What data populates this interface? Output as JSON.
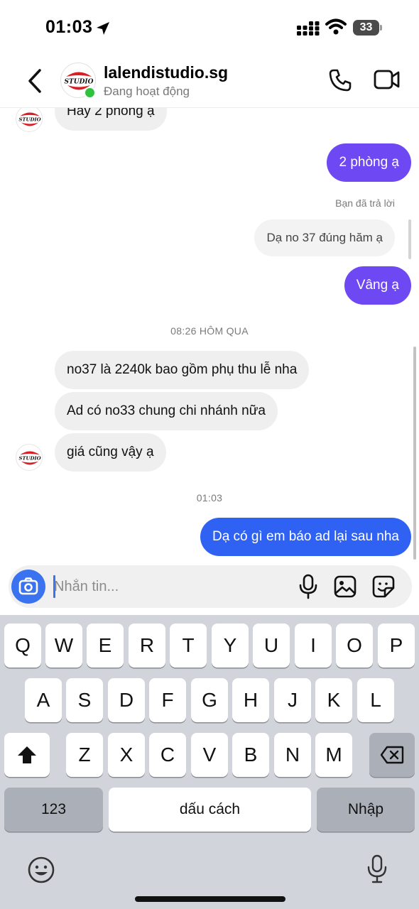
{
  "status_bar": {
    "time": "01:03",
    "battery": "33"
  },
  "header": {
    "contact_name": "lalendistudio.sg",
    "contact_status": "Đang hoạt động",
    "avatar_text": "STUDIO"
  },
  "messages": {
    "m1": "Hay 2 phòng ạ",
    "m2": "2 phòng ạ",
    "reply_label": "Bạn đã trả lời",
    "m3_quoted": "Dạ no 37 đúng hăm ạ",
    "m4": "Vâng ạ",
    "timestamp1": "08:26 HÔM QUA",
    "m5": "no37 là 2240k bao gồm phụ thu lễ nha",
    "m6": "Ad có no33 chung chi nhánh nữa",
    "m7": "giá cũng vậy ạ",
    "timestamp2": "01:03",
    "m8": "Dạ có gì em báo ad lại sau nha"
  },
  "composer": {
    "placeholder": "Nhắn tin...",
    "value": ""
  },
  "keyboard": {
    "row1": [
      "Q",
      "W",
      "E",
      "R",
      "T",
      "Y",
      "U",
      "I",
      "O",
      "P"
    ],
    "row2": [
      "A",
      "S",
      "D",
      "F",
      "G",
      "H",
      "J",
      "K",
      "L"
    ],
    "row3": [
      "Z",
      "X",
      "C",
      "V",
      "B",
      "N",
      "M"
    ],
    "numbers_key": "123",
    "space_key": "dấu cách",
    "return_key": "Nhập"
  },
  "colors": {
    "outgoing": "#6e48f2",
    "outgoing_latest": "#2f62f2",
    "incoming": "#efefef",
    "online": "#2fc23f",
    "camera": "#3a72f0"
  }
}
